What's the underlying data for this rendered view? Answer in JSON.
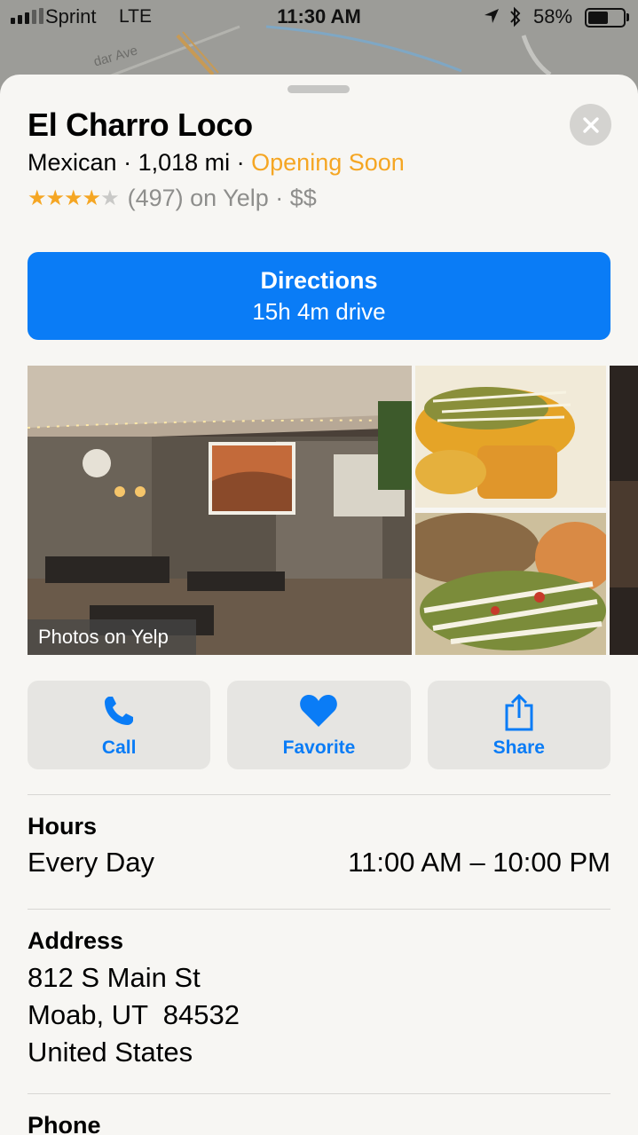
{
  "status_bar": {
    "carrier": "Sprint",
    "network": "LTE",
    "time": "11:30 AM",
    "battery_percent": "58%",
    "battery_level": 0.58,
    "signal_bars_filled": 3,
    "signal_bars_total": 5
  },
  "map": {
    "street_label": "dar Ave"
  },
  "place": {
    "name": "El Charro Loco",
    "category": "Mexican",
    "distance": "1,018 mi",
    "status": "Opening Soon",
    "rating_stars": 4,
    "rating_max": 5,
    "review_count": "(497)",
    "review_source": "on Yelp",
    "price": "$$"
  },
  "directions": {
    "label": "Directions",
    "duration": "15h 4m drive"
  },
  "photos": {
    "badge": "Photos on Yelp"
  },
  "actions": [
    {
      "label": "Call",
      "icon": "phone-icon"
    },
    {
      "label": "Favorite",
      "icon": "heart-icon"
    },
    {
      "label": "Share",
      "icon": "share-icon"
    }
  ],
  "hours": {
    "title": "Hours",
    "days": "Every Day",
    "time": "11:00 AM – 10:00 PM"
  },
  "address": {
    "title": "Address",
    "line1": "812 S Main St",
    "line2": "Moab, UT  84532",
    "line3": "United States"
  },
  "phone": {
    "title": "Phone"
  },
  "colors": {
    "accent": "#0a7cf6",
    "status_orange": "#f5a623",
    "sheet_bg": "#f7f6f3",
    "button_bg": "#e6e5e2"
  }
}
